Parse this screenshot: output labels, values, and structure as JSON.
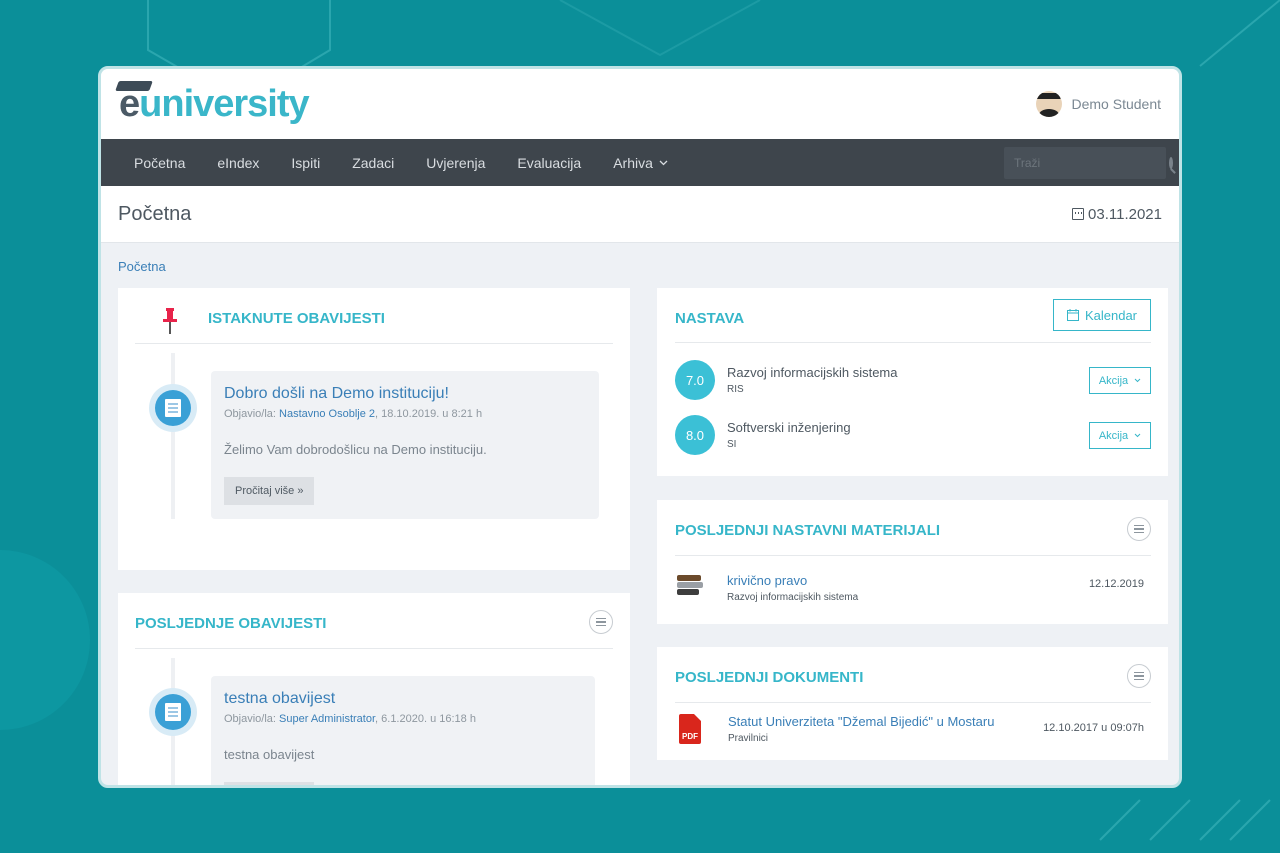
{
  "app": {
    "logo_prefix": "e",
    "logo_suffix": "university",
    "user_name": "Demo Student"
  },
  "nav": {
    "items": [
      {
        "label": "Početna"
      },
      {
        "label": "eIndex"
      },
      {
        "label": "Ispiti"
      },
      {
        "label": "Zadaci"
      },
      {
        "label": "Uvjerenja"
      },
      {
        "label": "Evaluacija"
      },
      {
        "label": "Arhiva",
        "has_dropdown": true
      }
    ],
    "search_placeholder": "Traži"
  },
  "page": {
    "title": "Početna",
    "date": "03.11.2021",
    "breadcrumb": "Početna"
  },
  "featured": {
    "title": "ISTAKNUTE OBAVIJESTI",
    "post": {
      "title": "Dobro došli na Demo instituciju!",
      "meta_prefix": "Objavio/la: ",
      "author": "Nastavno Osoblje 2",
      "meta_suffix": ", 18.10.2019. u 8:21 h",
      "body": "Želimo Vam dobrodošlicu na Demo instituciju.",
      "button": "Pročitaj više »"
    }
  },
  "latest": {
    "title": "POSLJEDNJE OBAVIJESTI",
    "post": {
      "title": "testna obavijest",
      "meta_prefix": "Objavio/la: ",
      "author": "Super Administrator",
      "meta_suffix": ", 6.1.2020. u 16:18 h",
      "body": "testna obavijest"
    }
  },
  "teaching": {
    "title": "NASTAVA",
    "calendar_button": "Kalendar",
    "courses": [
      {
        "grade": "7.0",
        "name": "Razvoj informacijskih sistema",
        "code": "RIS",
        "action": "Akcija"
      },
      {
        "grade": "8.0",
        "name": "Softverski inženjering",
        "code": "SI",
        "action": "Akcija"
      }
    ]
  },
  "materials": {
    "title": "POSLJEDNJI NASTAVNI MATERIJALI",
    "items": [
      {
        "name": "krivično pravo",
        "subject": "Razvoj informacijskih sistema",
        "date": "12.12.2019"
      }
    ]
  },
  "documents": {
    "title": "POSLJEDNJI DOKUMENTI",
    "items": [
      {
        "name": "Statut Univerziteta \"Džemal Bijedić\" u Mostaru",
        "category": "Pravilnici",
        "date": "12.10.2017 u 09:07h"
      }
    ]
  },
  "colors": {
    "background": "#0b8f99",
    "accent": "#36b6c9",
    "navbar": "#3e454c",
    "link": "#3a7fb7"
  }
}
